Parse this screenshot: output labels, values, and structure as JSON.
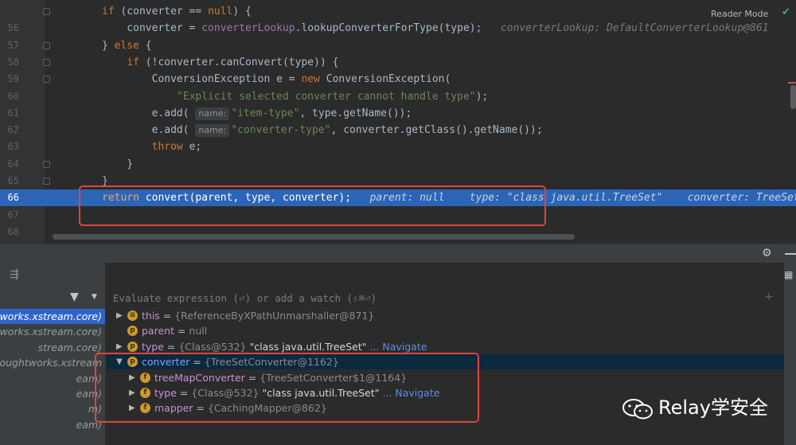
{
  "editor": {
    "reader_mode_label": "Reader Mode",
    "lines": [
      {
        "num": "",
        "tokens": [
          {
            "c": "kw",
            "t": "if "
          },
          {
            "t": "(converter == "
          },
          {
            "c": "kw",
            "t": "null"
          },
          {
            "t": ") {"
          }
        ]
      },
      {
        "num": "56",
        "tokens": [
          {
            "t": "    converter = "
          },
          {
            "c": "fld",
            "t": "converterLookup"
          },
          {
            "t": ".lookupConverterForType(type);   "
          },
          {
            "c": "hint",
            "t": "converterLookup: DefaultConverterLookup@861"
          }
        ]
      },
      {
        "num": "57",
        "tokens": [
          {
            "t": "} "
          },
          {
            "c": "kw",
            "t": "else "
          },
          {
            "t": "{"
          }
        ]
      },
      {
        "num": "58",
        "tokens": [
          {
            "t": "    "
          },
          {
            "c": "kw",
            "t": "if "
          },
          {
            "t": "(!converter.canConvert(type)) {"
          }
        ]
      },
      {
        "num": "59",
        "tokens": [
          {
            "t": "        ConversionException e = "
          },
          {
            "c": "kw",
            "t": "new "
          },
          {
            "t": "ConversionException("
          }
        ]
      },
      {
        "num": "60",
        "tokens": [
          {
            "t": "            "
          },
          {
            "c": "str",
            "t": "\"Explicit selected converter cannot handle type\""
          },
          {
            "t": ");"
          }
        ]
      },
      {
        "num": "61",
        "tokens": [
          {
            "t": "        e.add( "
          },
          {
            "c": "pname",
            "t": "name:"
          },
          {
            "c": "str",
            "t": "\"item-type\""
          },
          {
            "t": ", type.getName());"
          }
        ]
      },
      {
        "num": "62",
        "tokens": [
          {
            "t": "        e.add( "
          },
          {
            "c": "pname",
            "t": "name:"
          },
          {
            "c": "str",
            "t": "\"converter-type\""
          },
          {
            "t": ", converter.getClass().getName());"
          }
        ]
      },
      {
        "num": "63",
        "tokens": [
          {
            "t": "        "
          },
          {
            "c": "kw",
            "t": "throw "
          },
          {
            "t": "e;"
          }
        ]
      },
      {
        "num": "64",
        "tokens": [
          {
            "t": "    }"
          }
        ]
      },
      {
        "num": "65",
        "tokens": [
          {
            "t": "}"
          }
        ]
      },
      {
        "num": "66",
        "current": true,
        "tokens": [
          {
            "c": "kw",
            "t": "return "
          },
          {
            "t": "convert(parent, type, converter);   "
          },
          {
            "c": "hint",
            "t": "parent: null    type: \"class java.util.TreeSet\"    converter: TreeSetConverter"
          }
        ]
      },
      {
        "num": "67",
        "tokens": [
          {
            "t": ""
          }
        ]
      },
      {
        "num": "68",
        "tokens": [
          {
            "t": ""
          }
        ]
      }
    ]
  },
  "debugger": {
    "eval_placeholder": "Evaluate expression (⏎) or add a watch (⇧⌘⏎)",
    "frames": [
      {
        "label": "oughtworks.xstream.core)",
        "selected": true
      },
      {
        "label": "ntworks.xstream.core)"
      },
      {
        "label": "stream.core)"
      },
      {
        "label": "om.thoughtworks.xstream"
      },
      {
        "label": "eam)"
      },
      {
        "label": "eam)"
      },
      {
        "label": "m)"
      },
      {
        "label": "eam)"
      }
    ],
    "variables": [
      {
        "depth": 0,
        "expand": "collapsed",
        "badge": "≡",
        "name": "this",
        "value": "{ReferenceByXPathUnmarshaller@871}"
      },
      {
        "depth": 0,
        "expand": "none",
        "badge": "p",
        "name": "parent",
        "value": "null"
      },
      {
        "depth": 0,
        "expand": "collapsed",
        "badge": "p",
        "name": "type",
        "value": "{Class@532}",
        "str": "\"class java.util.TreeSet\"",
        "nav": "... Navigate"
      },
      {
        "depth": 0,
        "expand": "expanded",
        "badge": "p",
        "name": "converter",
        "value": "{TreeSetConverter@1162}",
        "selected": true
      },
      {
        "depth": 1,
        "expand": "collapsed",
        "badge": "f",
        "name": "treeMapConverter",
        "value": "{TreeSetConverter$1@1164}"
      },
      {
        "depth": 1,
        "expand": "collapsed",
        "badge": "f",
        "name": "type",
        "value": "{Class@532}",
        "str": "\"class java.util.TreeSet\"",
        "nav": "... Navigate"
      },
      {
        "depth": 1,
        "expand": "collapsed",
        "badge": "f",
        "name": "mapper",
        "value": "{CachingMapper@862}"
      }
    ]
  },
  "watermark": {
    "text": "Relay学安全",
    "icon": "wechat-icon"
  },
  "colors": {
    "annotation": "#e0443c",
    "current_line": "#2d65b6",
    "selected_frame": "#2f65ca"
  }
}
